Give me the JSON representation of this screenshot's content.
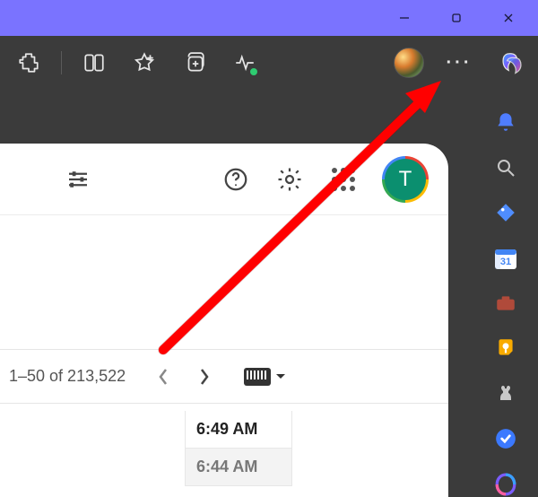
{
  "window": {
    "minimize_title": "Minimize",
    "maximize_title": "Restore",
    "close_title": "Close"
  },
  "toolbar": {
    "extension_label": "Extensions",
    "split_label": "Split screen",
    "favorites_label": "Favorites",
    "collections_label": "Collections",
    "performance_label": "Browser essentials",
    "profile_label": "Profile",
    "more_label": "Settings and more",
    "more_glyph": "···",
    "copilot_label": "Copilot"
  },
  "sidebar": {
    "items": [
      {
        "name": "notifications",
        "label": "Notifications"
      },
      {
        "name": "search",
        "label": "Search"
      },
      {
        "name": "shopping",
        "label": "Shopping"
      },
      {
        "name": "calendar",
        "label": "Calendar",
        "day": "31"
      },
      {
        "name": "tools",
        "label": "Tools"
      },
      {
        "name": "keep",
        "label": "Keep"
      },
      {
        "name": "games",
        "label": "Games"
      },
      {
        "name": "tasks",
        "label": "Tasks"
      },
      {
        "name": "m365",
        "label": "Microsoft 365"
      }
    ]
  },
  "gmail": {
    "filter_label": "Show search options",
    "help_label": "Support",
    "settings_label": "Settings",
    "apps_label": "Google apps",
    "account_initial": "T",
    "pager": {
      "range": "1–50 of 213,522",
      "prev_label": "Newer",
      "next_label": "Older",
      "input_label": "Select input tool"
    },
    "times": [
      "6:49 AM",
      "6:44 AM"
    ]
  }
}
